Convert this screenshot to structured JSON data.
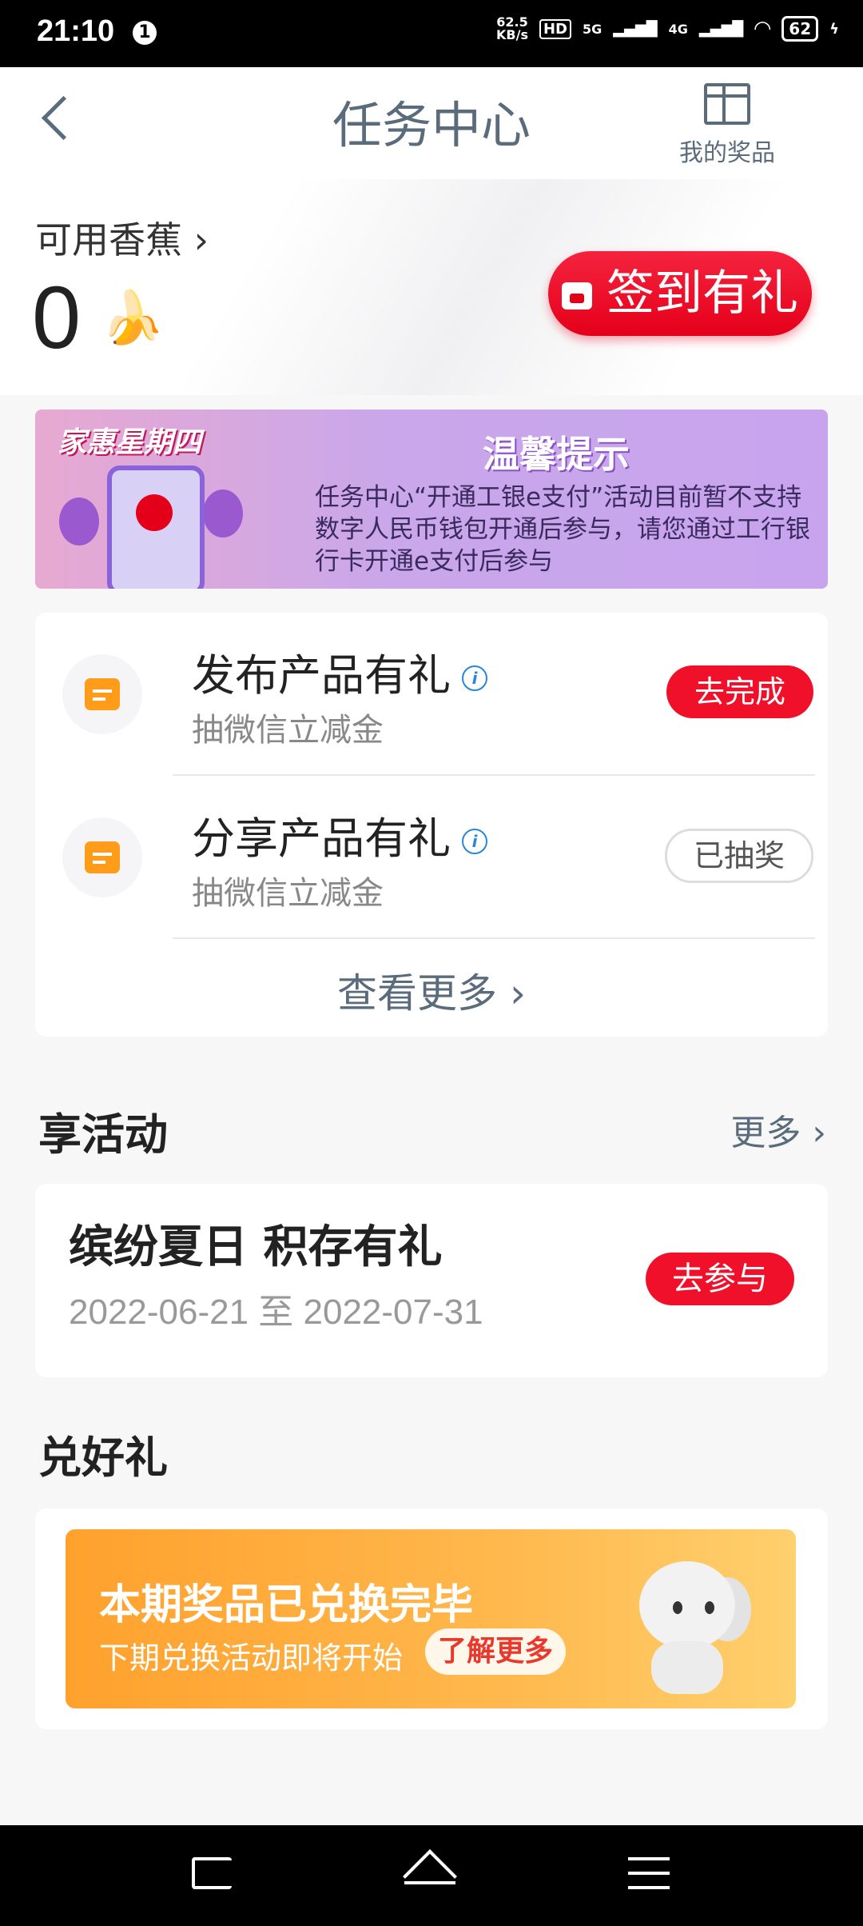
{
  "status": {
    "time": "21:10",
    "notif": "1",
    "speed_top": "62.5",
    "speed_unit": "KB/s",
    "hd": "HD",
    "net1": "5G",
    "net2": "4G",
    "battery": "62"
  },
  "header": {
    "title": "任务中心",
    "prize_label": "我的奖品"
  },
  "hero": {
    "available_label": "可用香蕉 ›",
    "count": "0",
    "signin_label": "签到有礼"
  },
  "banner": {
    "tag": "家惠星期四",
    "title": "温馨提示",
    "text": "任务中心“开通工银e支付”活动目前暂不支持数字人民币钱包开通后参与，请您通过工行银行卡开通e支付后参与"
  },
  "tasks": [
    {
      "name": "发布产品有礼",
      "sub": "抽微信立减金",
      "button": "去完成"
    },
    {
      "name": "分享产品有礼",
      "sub": "抽微信立减金",
      "button": "已抽奖"
    }
  ],
  "tasks_more": "查看更多 ›",
  "activities": {
    "title": "享活动",
    "more": "更多 ›",
    "item": {
      "name": "缤纷夏日 积存有礼",
      "date": "2022-06-21 至 2022-07-31",
      "button": "去参与"
    }
  },
  "exchange": {
    "title": "兑好礼",
    "main": "本期奖品已兑换完毕",
    "sub": "下期兑换活动即将开始",
    "button": "了解更多"
  }
}
